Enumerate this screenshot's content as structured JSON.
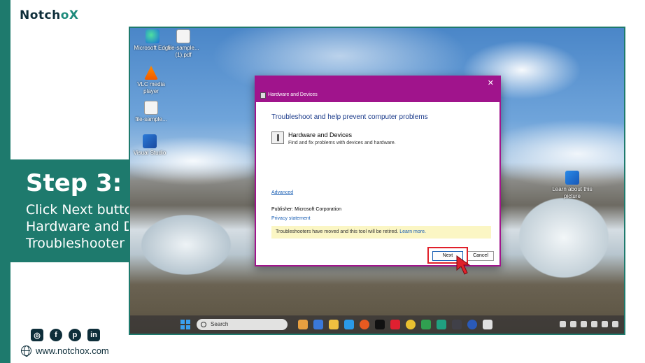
{
  "brand": {
    "name_part1": "Notch",
    "name_o": "o",
    "name_x": "X"
  },
  "step": {
    "title": "Step 3:",
    "description": "Click Next button in Hardware and Device Troubleshooter"
  },
  "social": {
    "icons": [
      "instagram-icon",
      "facebook-icon",
      "pinterest-icon",
      "linkedin-icon"
    ]
  },
  "website": "www.notchox.com",
  "desktop_icons": [
    {
      "label": "Microsoft Edge"
    },
    {
      "label": "file-sample... (1).pdf"
    },
    {
      "label": "VLC media player"
    },
    {
      "label": "file-sample..."
    },
    {
      "label": "Visual Studio"
    },
    {
      "label": "Learn about this picture"
    }
  ],
  "dialog": {
    "window_title": "Hardware and Devices",
    "heading": "Troubleshoot and help prevent computer problems",
    "item_title": "Hardware and Devices",
    "item_desc": "Find and fix problems with devices and hardware.",
    "advanced_link": "Advanced",
    "publisher": "Publisher:  Microsoft Corporation",
    "privacy_link": "Privacy statement",
    "notice_text": "Troubleshooters have moved and this tool will be retired.",
    "notice_link": "Learn more.",
    "next_label": "Next",
    "cancel_label": "Cancel"
  },
  "taskbar": {
    "search_placeholder": "Search"
  },
  "colors": {
    "accent": "#1e7a6d",
    "dialog_titlebar": "#a0148c",
    "highlight": "#e0202a"
  }
}
